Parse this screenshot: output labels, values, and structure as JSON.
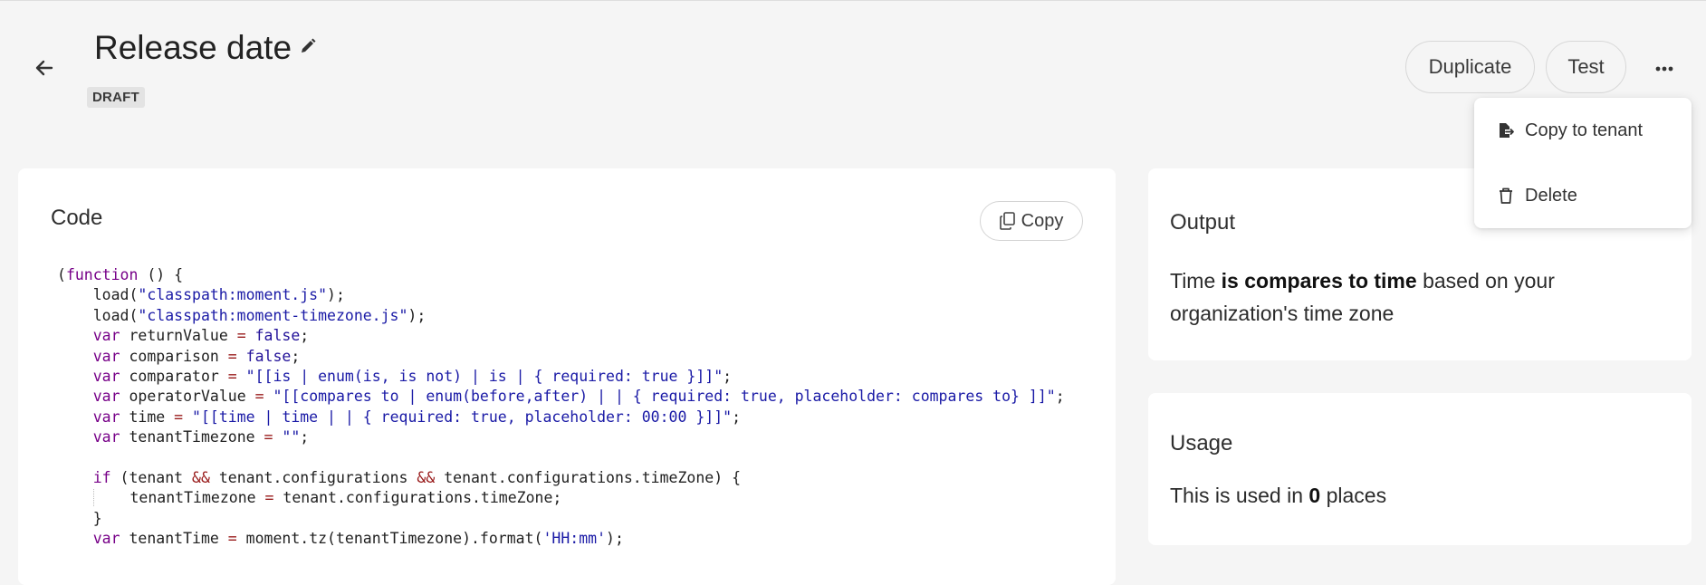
{
  "header": {
    "title": "Release date",
    "status": "DRAFT",
    "duplicate_label": "Duplicate",
    "test_label": "Test",
    "icons": [
      "back-arrow-icon",
      "pencil-icon",
      "ellipsis-icon"
    ]
  },
  "code_card": {
    "title": "Code",
    "copy_label": "Copy",
    "lines": [
      "(function () {",
      "    load(\"classpath:moment.js\");",
      "    load(\"classpath:moment-timezone.js\");",
      "    var returnValue = false;",
      "    var comparison = false;",
      "    var comparator = \"[[is | enum(is, is not) | is | { required: true }]]\";",
      "    var operatorValue = \"[[compares to | enum(before,after) | | { required: true, placeholder: compares to} ]]\";",
      "    var time = \"[[time | time | | { required: true, placeholder: 00:00 }]]\";",
      "    var tenantTimezone = \"\";",
      "",
      "    if (tenant && tenant.configurations && tenant.configurations.timeZone) {",
      "        tenantTimezone = tenant.configurations.timeZone;",
      "    }",
      "    var tenantTime = moment.tz(tenantTimezone).format('HH:mm');"
    ]
  },
  "output_card": {
    "title": "Output",
    "text_prefix": "Time ",
    "text_bold": "is compares to time",
    "text_suffix": " based on your organization's time zone"
  },
  "usage_card": {
    "title": "Usage",
    "text_prefix": "This is used in ",
    "count": "0",
    "text_suffix": " places"
  },
  "menu": {
    "items": [
      {
        "label": "Copy to tenant",
        "icon": "file-export-icon"
      },
      {
        "label": "Delete",
        "icon": "trash-icon"
      }
    ]
  },
  "colors": {
    "background": "#f5f5f5",
    "card": "#ffffff",
    "keyword": "#770088",
    "string": "#1a1aa6",
    "atom": "#221199"
  }
}
